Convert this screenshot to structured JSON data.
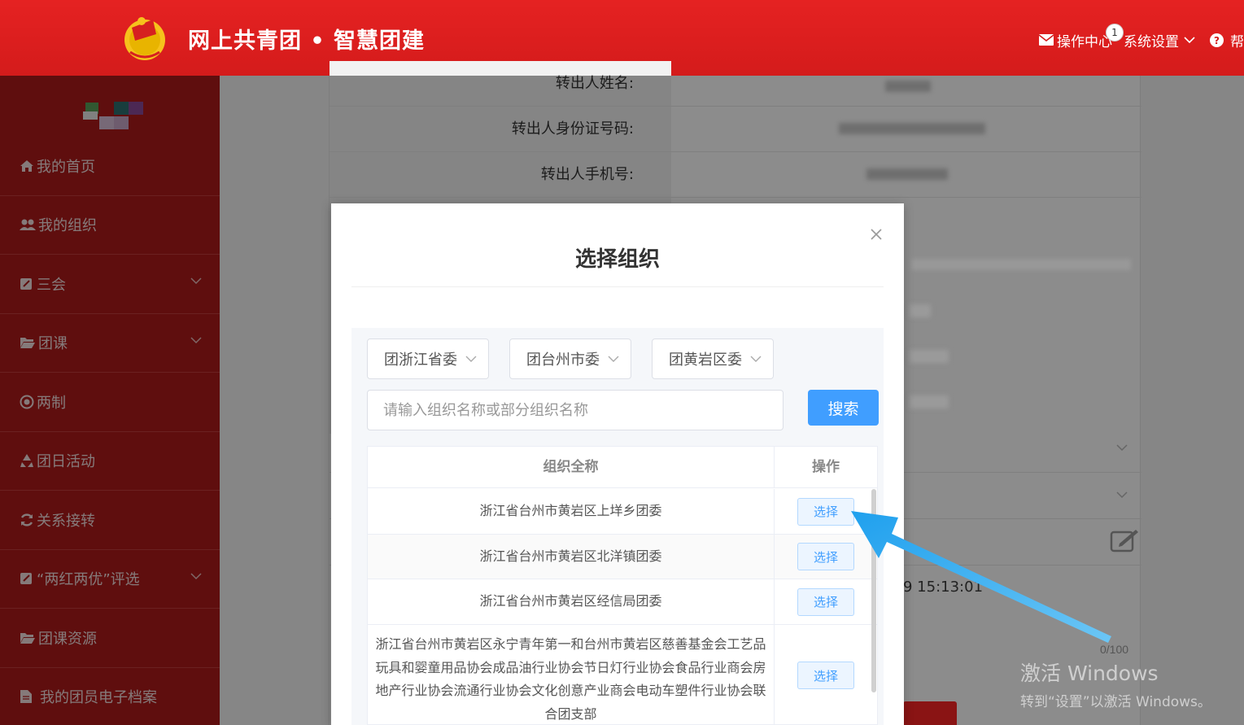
{
  "header": {
    "brand": "网上共青团 • 智慧团建",
    "nav": {
      "ops_center": "操作中心",
      "ops_badge": "1",
      "settings": "系统设置",
      "help": "帮"
    }
  },
  "sidebar": {
    "items": [
      {
        "label": "我的首页"
      },
      {
        "label": "我的组织"
      },
      {
        "label": "三会"
      },
      {
        "label": "团课"
      },
      {
        "label": "两制"
      },
      {
        "label": "团日活动"
      },
      {
        "label": "关系接转"
      },
      {
        "label": "“两红两优”评选"
      },
      {
        "label": "团课资源"
      },
      {
        "label": "我的团员电子档案"
      }
    ]
  },
  "background_form": {
    "rows": [
      {
        "label": "转出人姓名:"
      },
      {
        "label": "转出人身份证号码:"
      },
      {
        "label": "转出人手机号:"
      }
    ],
    "timestamp_fragment": "9 15:13:01",
    "char_count": "0/100"
  },
  "modal": {
    "title": "选择组织",
    "selects": [
      "团浙江省委",
      "团台州市委",
      "团黄岩区委"
    ],
    "search_placeholder": "请输入组织名称或部分组织名称",
    "search_button": "搜索",
    "table": {
      "headers": [
        "组织全称",
        "操作"
      ],
      "rows": [
        {
          "name": "浙江省台州市黄岩区上垟乡团委",
          "action": "选择"
        },
        {
          "name": "浙江省台州市黄岩区北洋镇团委",
          "action": "选择"
        },
        {
          "name": "浙江省台州市黄岩区经信局团委",
          "action": "选择"
        },
        {
          "name": "浙江省台州市黄岩区永宁青年第一和台州市黄岩区慈善基金会工艺品玩具和婴童用品协会成品油行业协会节日灯行业协会食品行业商会房地产行业协会流通行业协会文化创意产业商会电动车塑件行业协会联合团支部",
          "action": "选择"
        }
      ]
    }
  },
  "watermark": {
    "line1": "激活 Windows",
    "line2": "转到“设置”以激活 Windows。"
  },
  "colors": {
    "header_red": "#e02020",
    "sidebar_red": "#ad1b1b",
    "primary_blue": "#409eff",
    "annotation_arrow": "#2ea8f0"
  }
}
